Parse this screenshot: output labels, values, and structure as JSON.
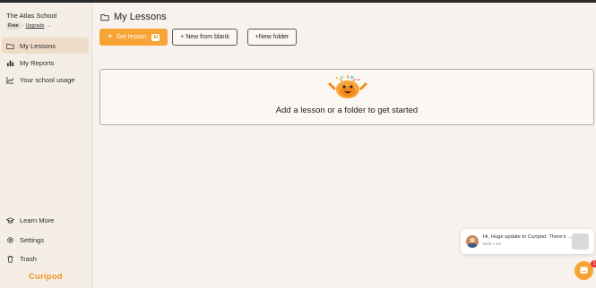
{
  "sidebar": {
    "school_name": "The Atlas School",
    "plan_badge": "Free",
    "upgrade_label": "Upgrade",
    "upgrade_prefix": "-",
    "upgrade_arrow": "→",
    "nav": [
      {
        "label": "My Lessons",
        "icon": "folder-icon",
        "active": true
      },
      {
        "label": "My Reports",
        "icon": "bar-chart-icon",
        "active": false
      },
      {
        "label": "Your school usage",
        "icon": "line-chart-icon",
        "active": false
      }
    ],
    "bottom_nav": [
      {
        "label": "Learn More",
        "icon": "graduation-cap-icon"
      },
      {
        "label": "Settings",
        "icon": "gear-icon"
      },
      {
        "label": "Trash",
        "icon": "trash-icon"
      }
    ],
    "logo_text": "Curipod"
  },
  "main": {
    "title": "My Lessons",
    "buttons": {
      "get_lesson": "Get lesson",
      "ai_badge": "AI",
      "new_from_blank": "+ New from blank",
      "new_folder": "+New folder"
    },
    "empty_state": "Add a lesson or a folder to get started"
  },
  "chat": {
    "message": "Hi, Huge update to Curipod: There's a new",
    "sender_meta": "Eirik • 1m",
    "badge_count": "1"
  },
  "colors": {
    "accent": "#f7a436",
    "brand_logo": "#f0921e",
    "active_nav": "#efdcc8",
    "notification": "#e5322d"
  }
}
